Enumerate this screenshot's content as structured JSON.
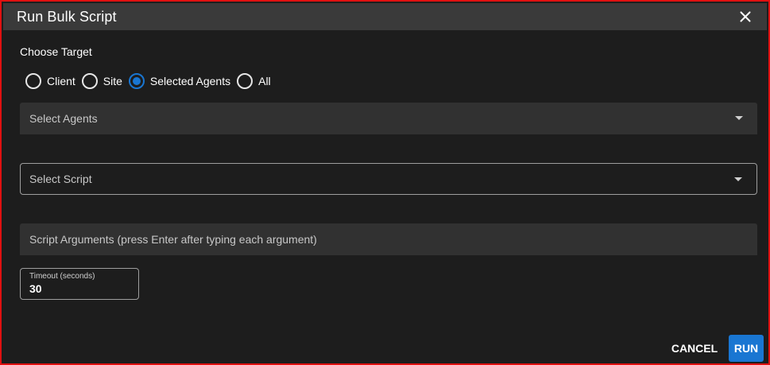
{
  "dialog": {
    "title": "Run Bulk Script",
    "close_icon": "close-icon"
  },
  "target": {
    "label": "Choose Target",
    "options": [
      {
        "label": "Client",
        "checked": false
      },
      {
        "label": "Site",
        "checked": false
      },
      {
        "label": "Selected Agents",
        "checked": true
      },
      {
        "label": "All",
        "checked": false
      }
    ]
  },
  "agents_select": {
    "placeholder": "Select Agents",
    "icon": "dropdown-arrow-icon"
  },
  "script_select": {
    "placeholder": "Select Script",
    "icon": "dropdown-arrow-icon"
  },
  "arguments_field": {
    "placeholder": "Script Arguments (press Enter after typing each argument)"
  },
  "timeout": {
    "label": "Timeout (seconds)",
    "value": "30"
  },
  "actions": {
    "cancel_label": "CANCEL",
    "run_label": "RUN"
  },
  "colors": {
    "accent": "#1976d2",
    "title_bar": "#3a3a3a",
    "background": "#1d1d1d",
    "field_background": "#313131",
    "frame_border": "#e01010"
  }
}
